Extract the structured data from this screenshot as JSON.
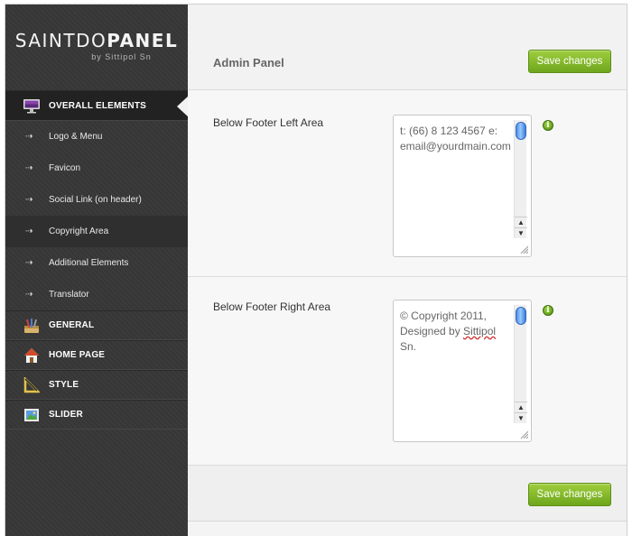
{
  "brand": {
    "title_light": "SAINTDO",
    "title_bold": "PANEL",
    "subtitle": "by Sittipol Sn"
  },
  "sidebar": {
    "main_items": [
      {
        "label": "OVERALL ELEMENTS",
        "icon": "monitor-icon",
        "active": true
      },
      {
        "label": "GENERAL",
        "icon": "tools-icon"
      },
      {
        "label": "HOME PAGE",
        "icon": "home-icon"
      },
      {
        "label": "STYLE",
        "icon": "ruler-icon"
      },
      {
        "label": "SLIDER",
        "icon": "picture-icon"
      }
    ],
    "sub_arrow": "⇢",
    "sub_items": [
      {
        "label": "Logo & Menu"
      },
      {
        "label": "Favicon"
      },
      {
        "label": "Social Link (on header)"
      },
      {
        "label": "Copyright Area",
        "current": true
      },
      {
        "label": "Additional Elements"
      },
      {
        "label": "Translator"
      }
    ]
  },
  "header": {
    "title": "Admin Panel",
    "save_label": "Save changes"
  },
  "fields": [
    {
      "label": "Below Footer Left Area",
      "value": "t: (66) 8 123 4567 e: email@yourdmain.com"
    },
    {
      "label": "Below Footer Right Area",
      "value_prefix": "© Copyright 2011, Designed by ",
      "value_misspelled": "Sittipol",
      "value_suffix": " Sn."
    }
  ],
  "footer": {
    "save_label": "Save changes"
  },
  "info_glyph": "i",
  "colors": {
    "sidebar_bg": "#373737",
    "accent_green": "#7ab327",
    "content_bg": "#f2f2f2"
  }
}
